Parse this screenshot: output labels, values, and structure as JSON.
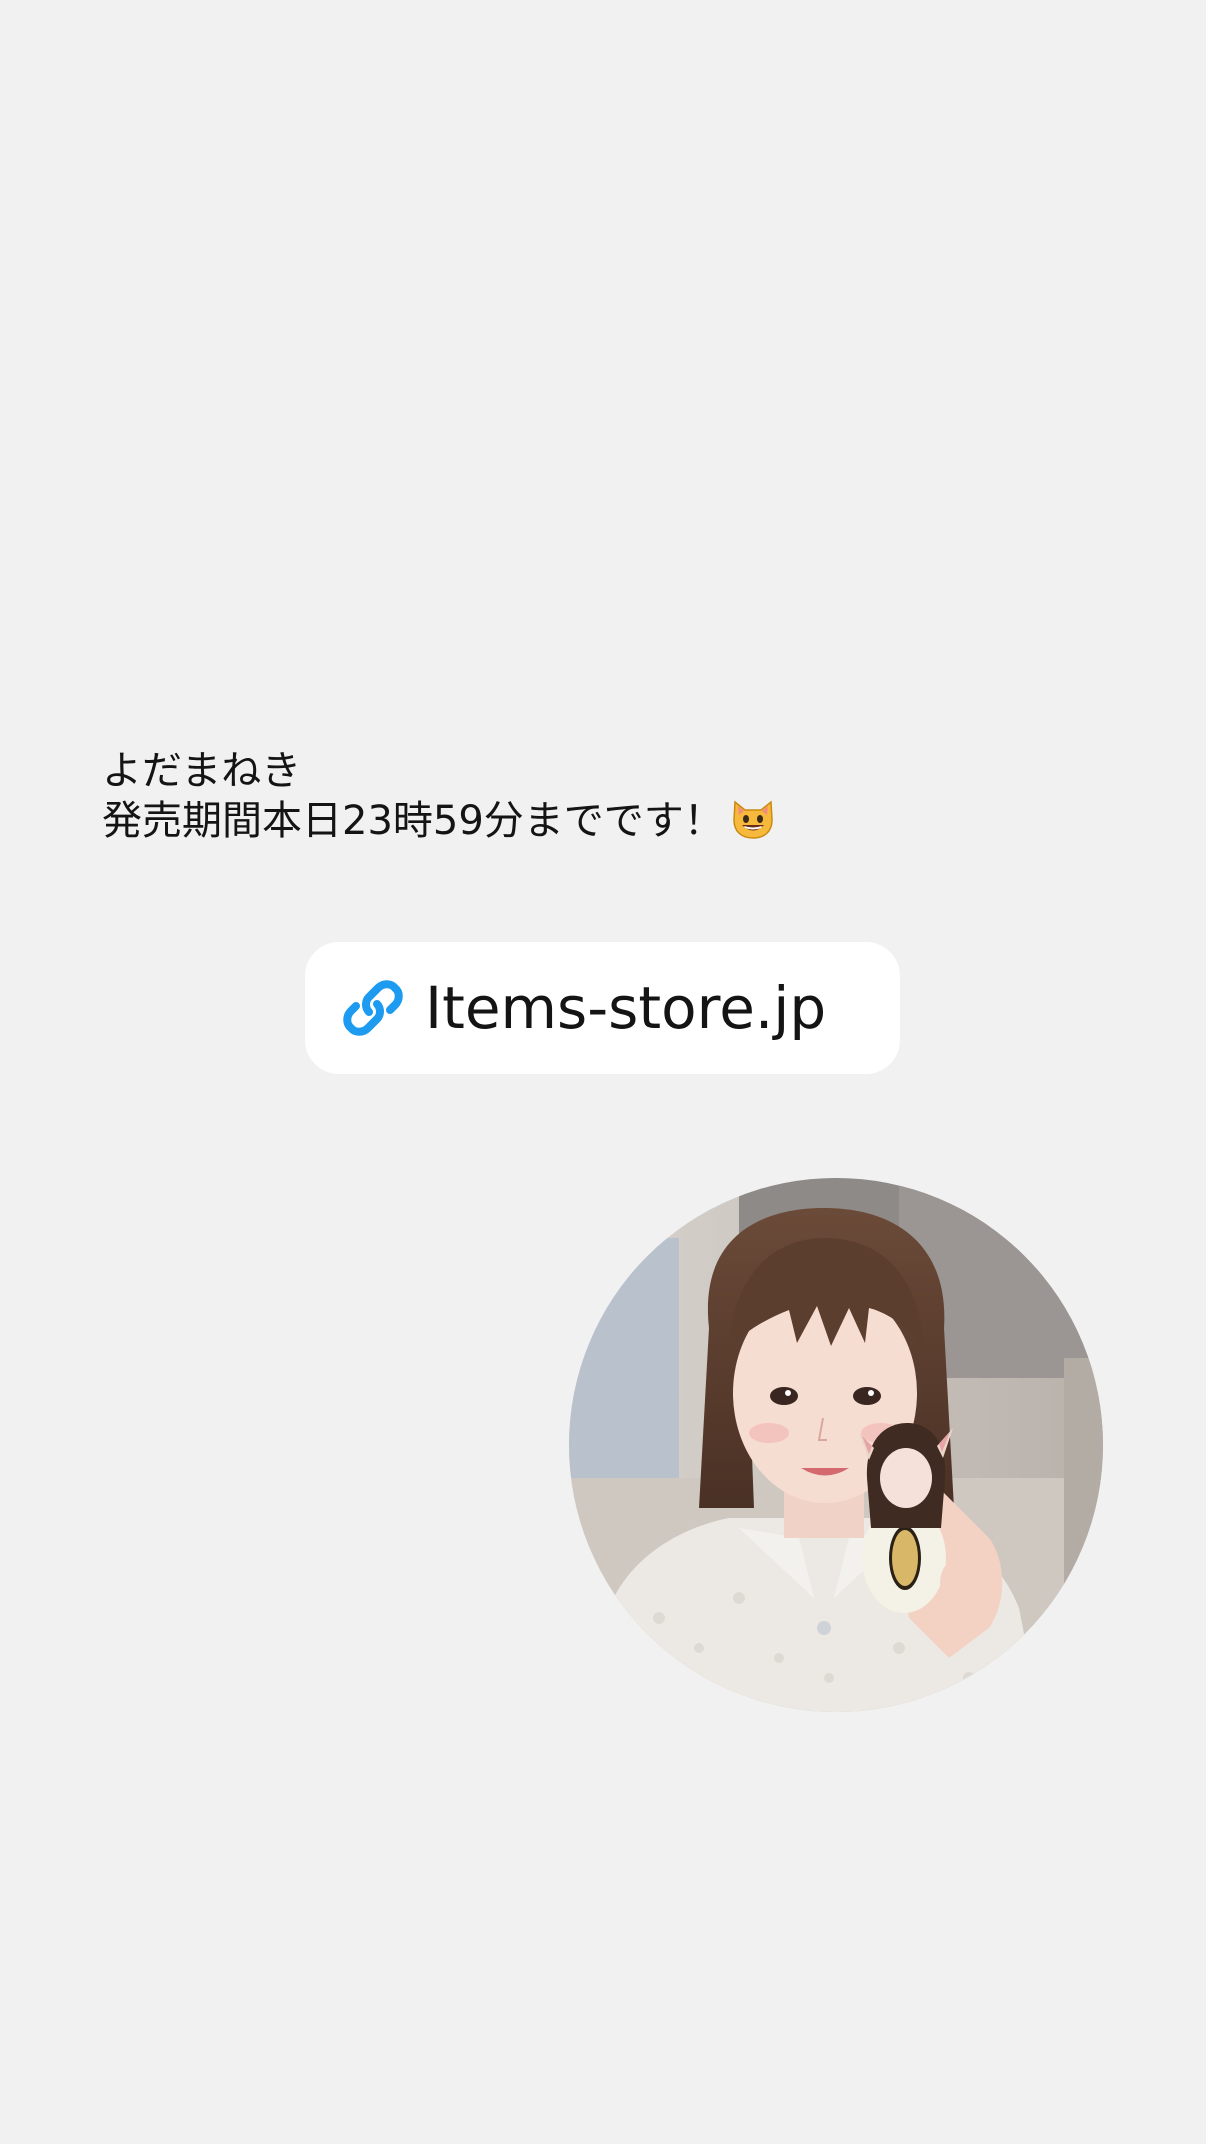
{
  "caption": {
    "line1": "よだまねき",
    "line2": "発売期間本日23時59分までです！",
    "emoji": "grinning-cat-emoji"
  },
  "link_sticker": {
    "label": "Items-store.jp",
    "icon": "link-icon",
    "icon_color": "#1d9bf0"
  },
  "photo": {
    "shape": "circle"
  },
  "colors": {
    "background": "#f2f1f1",
    "sticker_background": "#ffffff",
    "text": "#141414"
  }
}
